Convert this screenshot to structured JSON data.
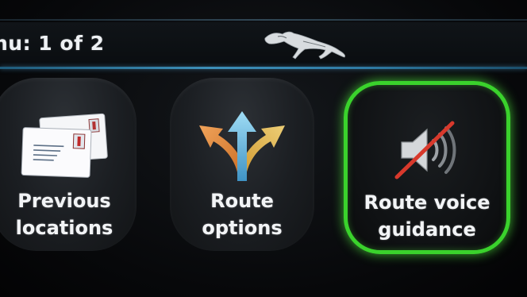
{
  "header": {
    "title": "nu: 1 of 2",
    "logo_icon": "jaguar-leaper-logo-icon"
  },
  "menu": {
    "items": [
      {
        "line1": "Previous",
        "line2": "locations",
        "icon": "address-cards-icon",
        "selected": false
      },
      {
        "line1": "Route",
        "line2": "options",
        "icon": "route-arrows-icon",
        "selected": false
      },
      {
        "line1": "Route voice",
        "line2": "guidance",
        "icon": "speaker-muted-icon",
        "selected": true
      }
    ]
  },
  "colors": {
    "selection_highlight": "#3ad22c",
    "header_divider": "#3d8fb8",
    "background": "#050608",
    "text": "#f2f4f6"
  }
}
